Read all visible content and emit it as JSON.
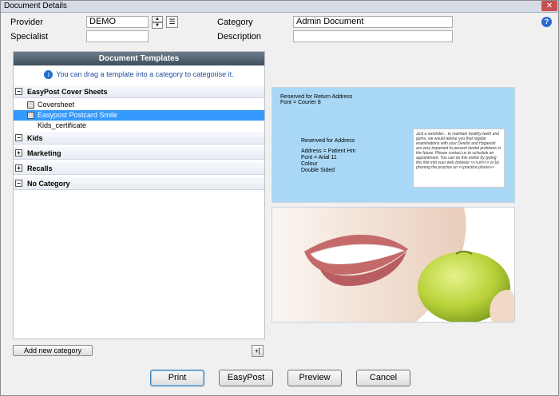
{
  "window": {
    "title": "Document Details"
  },
  "form": {
    "provider_label": "Provider",
    "provider_value": "DEMO",
    "specialist_label": "Specialist",
    "specialist_value": "",
    "category_label": "Category",
    "category_value": "Admin Document",
    "description_label": "Description",
    "description_value": ""
  },
  "templates": {
    "header": "Document Templates",
    "hint": "You can drag a template into a category to categorise it.",
    "categories": [
      {
        "label": "EasyPost Cover Sheets",
        "expanded": true,
        "items": [
          {
            "label": "Coversheet"
          },
          {
            "label": "Easypost Postcard Smile",
            "selected": true
          },
          {
            "label": "Kids_certificate"
          }
        ]
      },
      {
        "label": "Kids",
        "expanded": true
      },
      {
        "label": "Marketing",
        "expanded": false
      },
      {
        "label": "Recalls",
        "expanded": false
      },
      {
        "label": "No Category",
        "expanded": true
      }
    ]
  },
  "preview": {
    "return_address": "Reserved for Return Address",
    "return_font": "Font = Courier 8",
    "address_reserved": "Reserved for Address",
    "address_lines": [
      "Address = Patient Hm",
      "Font = Arial 11",
      "Colour",
      "Double Sided"
    ],
    "card_text": "Just a reminder... to maintain healthy teeth and gums, we would advise you that regular examinations with your Dentist and Hygienist are very important to prevent dental problems in the future. Please contact us to schedule an appointment. You can do this online by typing this link into your web browser <<<url>>> or by phoning the practice on <<practice phone>>"
  },
  "buttons": {
    "add_category": "Add new category",
    "print": "Print",
    "easypost": "EasyPost",
    "preview": "Preview",
    "cancel": "Cancel"
  },
  "colors": {
    "selected": "#3399ff",
    "header": "#4f5f6c",
    "preview_bg": "#a8d8f5"
  }
}
